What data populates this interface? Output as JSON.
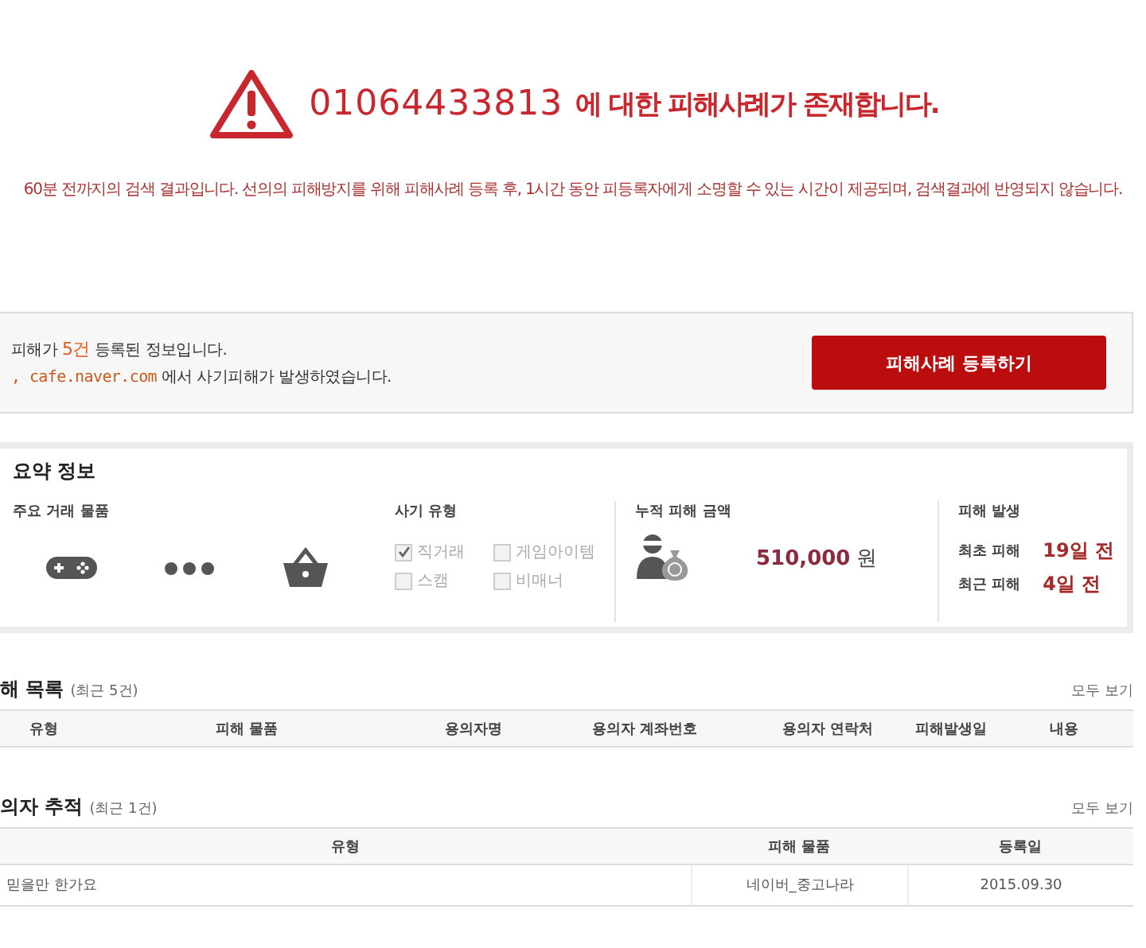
{
  "alert": {
    "number": "01064433813",
    "message": "에 대한 피해사례가 존재합니다."
  },
  "notice": "60분 전까지의 검색 결과입니다. 선의의 피해방지를 위해 피해사례 등록 후, 1시간 동안 피등록자에게 소명할 수 있는 시간이 제공되며, 검색결과에 반영되지 않습니다.",
  "info": {
    "prefix": "피해가",
    "count": "5건",
    "suffix": "등록된 정보입니다.",
    "site": ", cafe.naver.com",
    "site_suffix": "에서 사기피해가 발생하였습니다.",
    "button": "피해사례 등록하기"
  },
  "summary": {
    "title": "요약 정보",
    "items_label": "주요 거래 물품",
    "fraud_types": {
      "label": "사기 유형",
      "options": [
        {
          "label": "직거래",
          "checked": true
        },
        {
          "label": "게임아이템",
          "checked": false
        },
        {
          "label": "스캠",
          "checked": false
        },
        {
          "label": "비매너",
          "checked": false
        }
      ]
    },
    "total": {
      "label": "누적 피해 금액",
      "amount": "510,000",
      "unit": "원"
    },
    "occurrence": {
      "label": "피해 발생",
      "rows": [
        {
          "label": "최초 피해",
          "value": "19일 전"
        },
        {
          "label": "최근 피해",
          "value": "4일 전"
        }
      ]
    }
  },
  "damage_list": {
    "title": "해 목록",
    "note": "(최근 5건)",
    "view_all": "모두 보기",
    "columns": [
      "유형",
      "피해 물품",
      "용의자명",
      "용의자 계좌번호",
      "용의자 연락처",
      "피해발생일",
      "내용"
    ]
  },
  "suspect_tracking": {
    "title": "의자 추적",
    "note": "(최근 1건)",
    "view_all": "모두 보기",
    "columns": [
      "유형",
      "피해 물품",
      "등록일"
    ],
    "rows": [
      [
        "믿을만 한가요",
        "네이버_중고나라",
        "2015.09.30"
      ]
    ]
  }
}
